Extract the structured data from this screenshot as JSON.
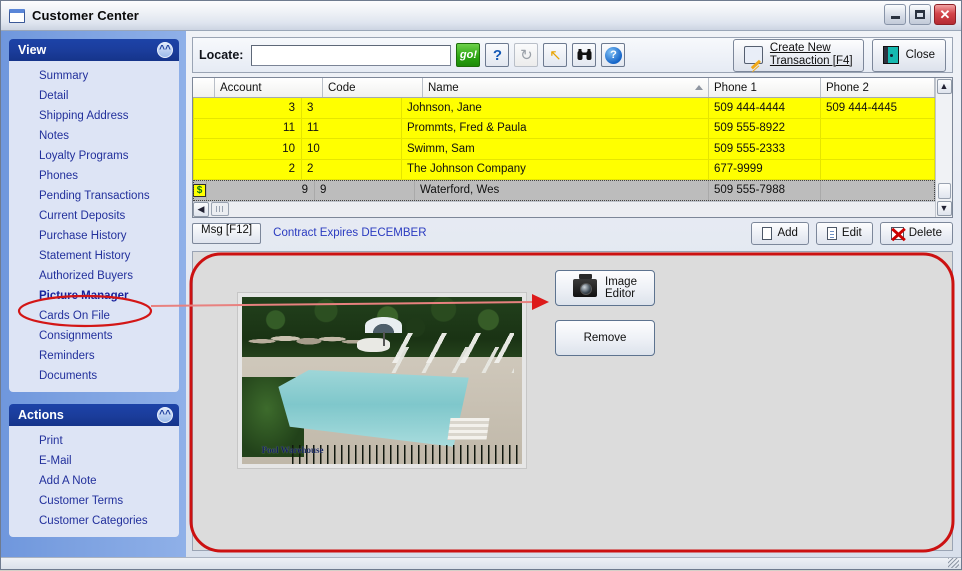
{
  "window": {
    "title": "Customer Center",
    "app_icon": "window-icon",
    "minimize": "–",
    "maximize": "□",
    "close": "✕"
  },
  "sidebar": {
    "view_panel": {
      "title": "View",
      "collapse_icon": "chevrons-up-icon",
      "items": [
        {
          "label": "Summary",
          "active": false
        },
        {
          "label": "Detail",
          "active": false
        },
        {
          "label": "Shipping Address",
          "active": false
        },
        {
          "label": "Notes",
          "active": false
        },
        {
          "label": "Loyalty Programs",
          "active": false
        },
        {
          "label": "Phones",
          "active": false
        },
        {
          "label": "Pending Transactions",
          "active": false
        },
        {
          "label": "Current Deposits",
          "active": false
        },
        {
          "label": "Purchase History",
          "active": false
        },
        {
          "label": "Statement History",
          "active": false
        },
        {
          "label": "Authorized Buyers",
          "active": false
        },
        {
          "label": "Picture Manager",
          "active": true
        },
        {
          "label": "Cards On File",
          "active": false
        },
        {
          "label": "Consignments",
          "active": false
        },
        {
          "label": "Reminders",
          "active": false
        },
        {
          "label": "Documents",
          "active": false
        }
      ]
    },
    "actions_panel": {
      "title": "Actions",
      "collapse_icon": "chevrons-up-icon",
      "items": [
        {
          "label": "Print"
        },
        {
          "label": "E-Mail"
        },
        {
          "label": "Add A Note"
        },
        {
          "label": "Customer Terms"
        },
        {
          "label": "Customer Categories"
        }
      ]
    }
  },
  "toolbar": {
    "locate_label": "Locate:",
    "locate_value": "",
    "locate_placeholder": "",
    "go_label": "go!",
    "question_label": "?",
    "refresh_label": "↻",
    "arrow_label": "↖",
    "binoculars_label": "👓",
    "help_label": "?",
    "create_new_line1": "Create New",
    "create_new_line2": "Transaction [F4]",
    "close_label": "Close"
  },
  "grid": {
    "columns": [
      "Account",
      "Code",
      "Name",
      "Phone 1",
      "Phone 2"
    ],
    "sorted_column": "Name",
    "rows": [
      {
        "indicator": "",
        "account": "3",
        "code": "3",
        "name": "Johnson, Jane",
        "phone1": "509  444-4444",
        "phone2": "509  444-4445",
        "selected": false
      },
      {
        "indicator": "",
        "account": "11",
        "code": "11",
        "name": "Prommts, Fred & Paula",
        "phone1": "509  555-8922",
        "phone2": "",
        "selected": false
      },
      {
        "indicator": "",
        "account": "10",
        "code": "10",
        "name": "Swimm, Sam",
        "phone1": "509  555-2333",
        "phone2": "",
        "selected": false
      },
      {
        "indicator": "",
        "account": "2",
        "code": "2",
        "name": "The Johnson Company",
        "phone1": "677-9999",
        "phone2": "",
        "selected": false
      },
      {
        "indicator": "$",
        "account": "9",
        "code": "9",
        "name": "Waterford, Wes",
        "phone1": "509  555-7988",
        "phone2": "",
        "selected": true
      }
    ],
    "scroll_up": "▲",
    "scroll_down": "▼",
    "scroll_left": "◀",
    "scroll_right": "▶"
  },
  "msgbar": {
    "msg_button": "Msg [F12]",
    "message": "Contract Expires DECEMBER",
    "add_label": "Add",
    "edit_label": "Edit",
    "delete_label": "Delete"
  },
  "picture_pane": {
    "image_editor_line1": "Image",
    "image_editor_line2": "Editor",
    "remove_label": "Remove",
    "photo_watermark": "Pool Warehouse",
    "camera_icon": "camera-icon"
  },
  "annotations": {
    "highlight_color": "#d31616",
    "arrow_color": "#e8817f",
    "circled_item": "Picture Manager",
    "arrow_target": "Image Editor"
  }
}
